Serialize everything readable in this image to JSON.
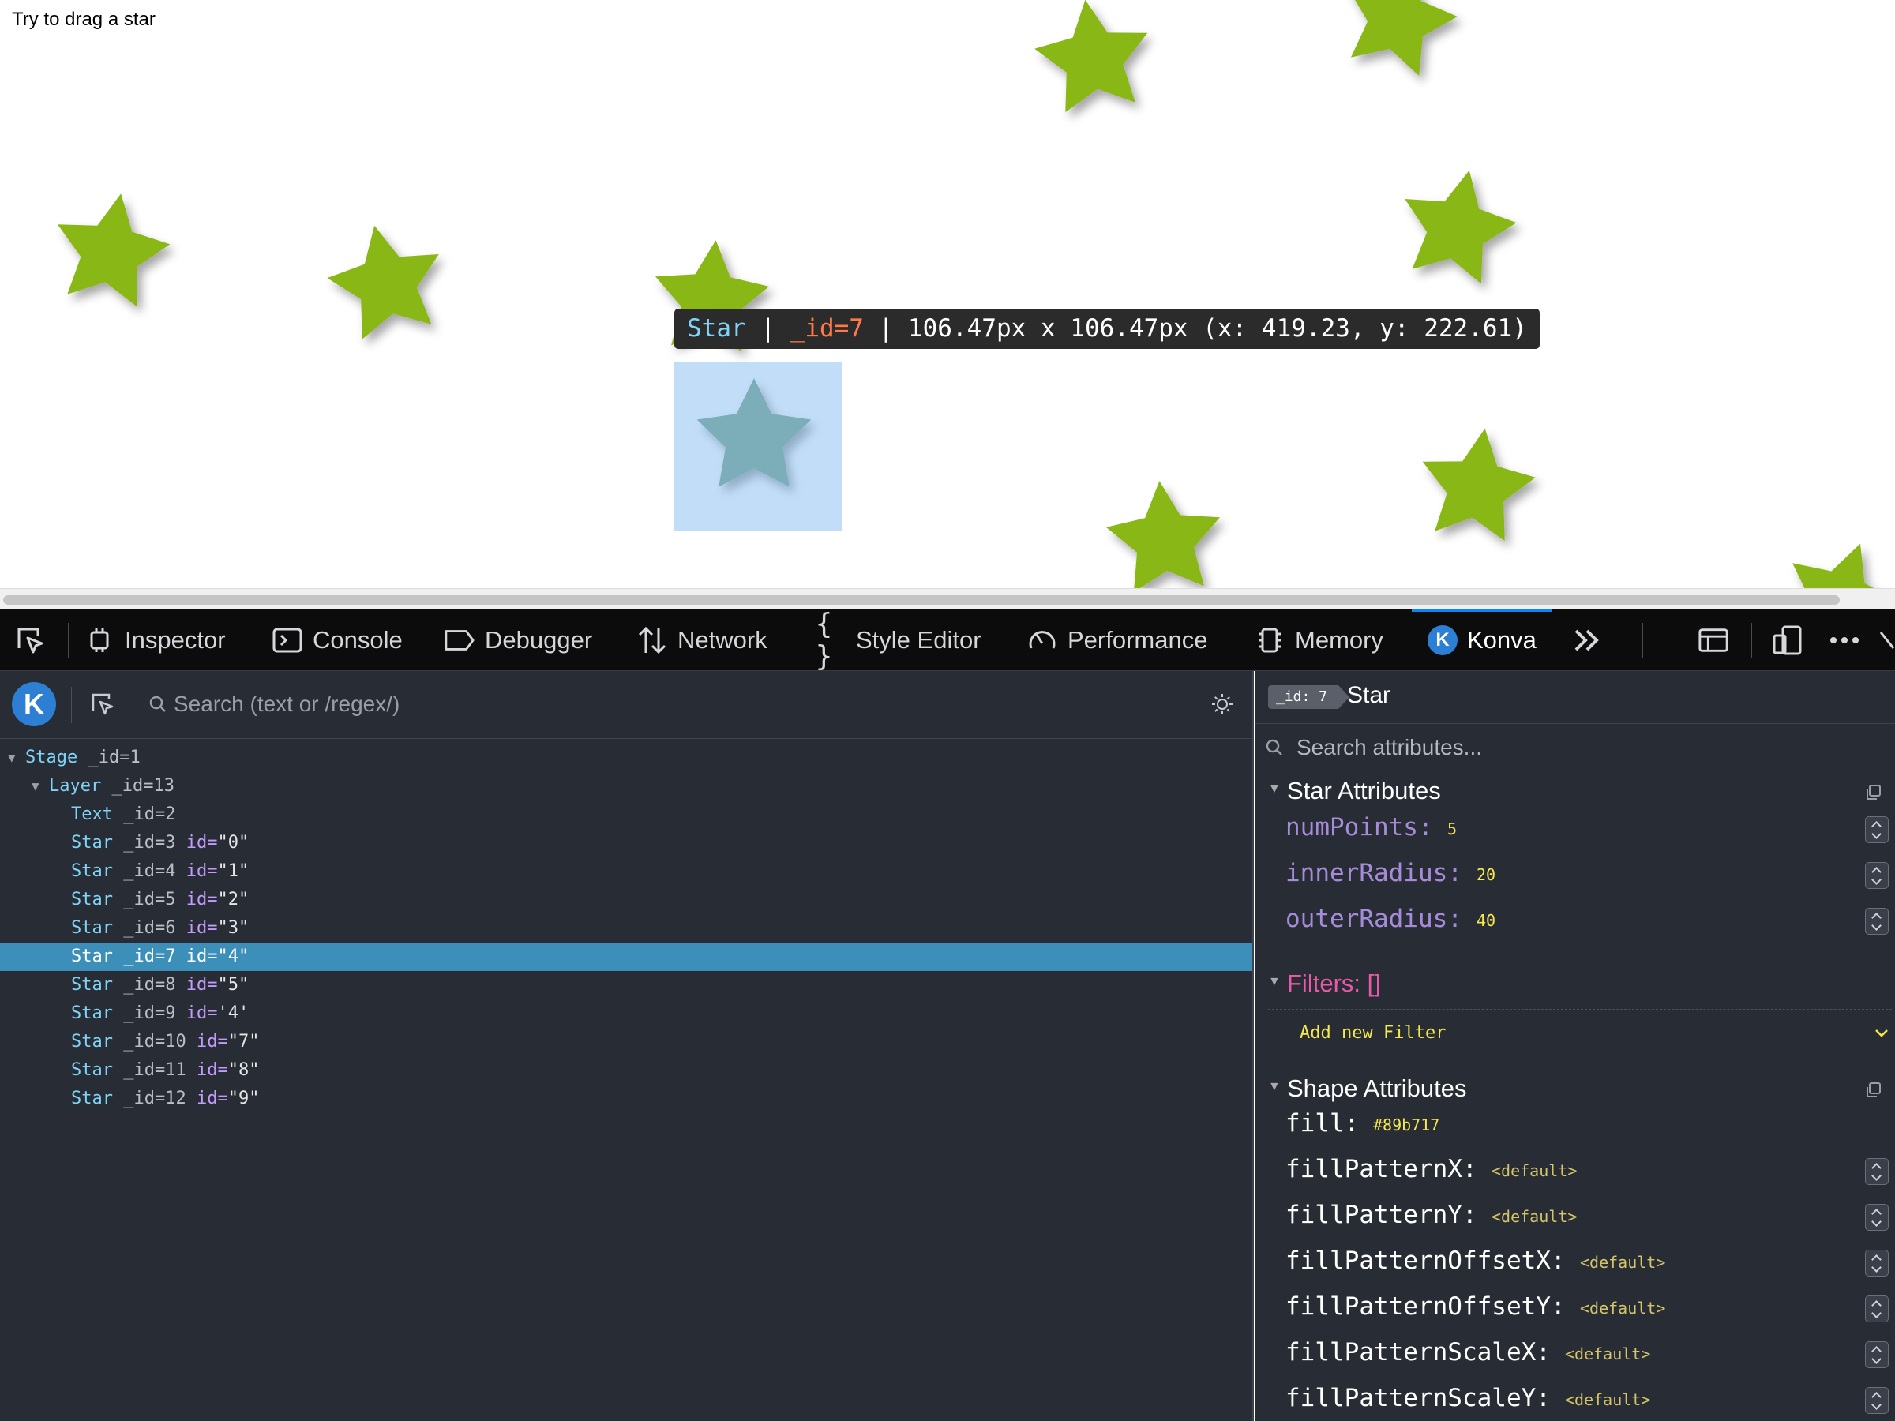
{
  "page": {
    "text": "Try to drag a star",
    "star_color": "#89b717",
    "highlight_color": "#b8d9f5"
  },
  "tooltip": {
    "type": "Star",
    "sep1": " | ",
    "id": "_id=7",
    "sep2": " | ",
    "size": "106.47px x 106.47px (x: 419.23, y: 222.61)"
  },
  "toolbar": {
    "tabs": [
      {
        "label": "Inspector",
        "icon": "inspector-icon"
      },
      {
        "label": "Console",
        "icon": "console-icon"
      },
      {
        "label": "Debugger",
        "icon": "debugger-icon"
      },
      {
        "label": "Network",
        "icon": "network-icon"
      },
      {
        "label": "Style Editor",
        "icon": "style-editor-icon"
      },
      {
        "label": "Performance",
        "icon": "performance-icon"
      },
      {
        "label": "Memory",
        "icon": "memory-icon"
      },
      {
        "label": "Konva",
        "icon": "konva-icon",
        "active": true
      }
    ],
    "konva_badge": "K"
  },
  "left": {
    "logo": "K",
    "search_placeholder": "Search (text or /regex/)",
    "tree": [
      {
        "name": "Stage",
        "id_label": "_id=1",
        "attr": "",
        "val": ""
      },
      {
        "name": "Layer",
        "id_label": "_id=13",
        "attr": "",
        "val": ""
      },
      {
        "name": "Text",
        "id_label": "_id=2",
        "attr": "",
        "val": ""
      },
      {
        "name": "Star",
        "id_label": "_id=3",
        "attr": "id=",
        "val": "\"0\""
      },
      {
        "name": "Star",
        "id_label": "_id=4",
        "attr": "id=",
        "val": "\"1\""
      },
      {
        "name": "Star",
        "id_label": "_id=5",
        "attr": "id=",
        "val": "\"2\""
      },
      {
        "name": "Star",
        "id_label": "_id=6",
        "attr": "id=",
        "val": "\"3\""
      },
      {
        "name": "Star",
        "id_label": "_id=7",
        "attr": "id=",
        "val": "\"4\"",
        "selected": true
      },
      {
        "name": "Star",
        "id_label": "_id=8",
        "attr": "id=",
        "val": "\"5\""
      },
      {
        "name": "Star",
        "id_label": "_id=9",
        "attr": "id=",
        "val": "'4'"
      },
      {
        "name": "Star",
        "id_label": "_id=10",
        "attr": "id=",
        "val": "\"7\""
      },
      {
        "name": "Star",
        "id_label": "_id=11",
        "attr": "id=",
        "val": "\"8\""
      },
      {
        "name": "Star",
        "id_label": "_id=12",
        "attr": "id=",
        "val": "\"9\""
      }
    ]
  },
  "right": {
    "id_chip": "_id: 7",
    "title": "Star",
    "search_placeholder": "Search attributes...",
    "star_section": "Star Attributes",
    "star_attrs": [
      {
        "name": "numPoints:",
        "value": "5"
      },
      {
        "name": "innerRadius:",
        "value": "20"
      },
      {
        "name": "outerRadius:",
        "value": "40"
      }
    ],
    "filters_label": "Filters: []",
    "add_filter": "Add new Filter",
    "shape_section": "Shape Attributes",
    "shape_attrs": [
      {
        "name": "fill:",
        "value": "#89b717"
      },
      {
        "name": "fillPatternX:",
        "value": "<default>"
      },
      {
        "name": "fillPatternY:",
        "value": "<default>"
      },
      {
        "name": "fillPatternOffsetX:",
        "value": "<default>"
      },
      {
        "name": "fillPatternOffsetY:",
        "value": "<default>"
      },
      {
        "name": "fillPatternScaleX:",
        "value": "<default>"
      },
      {
        "name": "fillPatternScaleY:",
        "value": "<default>"
      }
    ]
  }
}
